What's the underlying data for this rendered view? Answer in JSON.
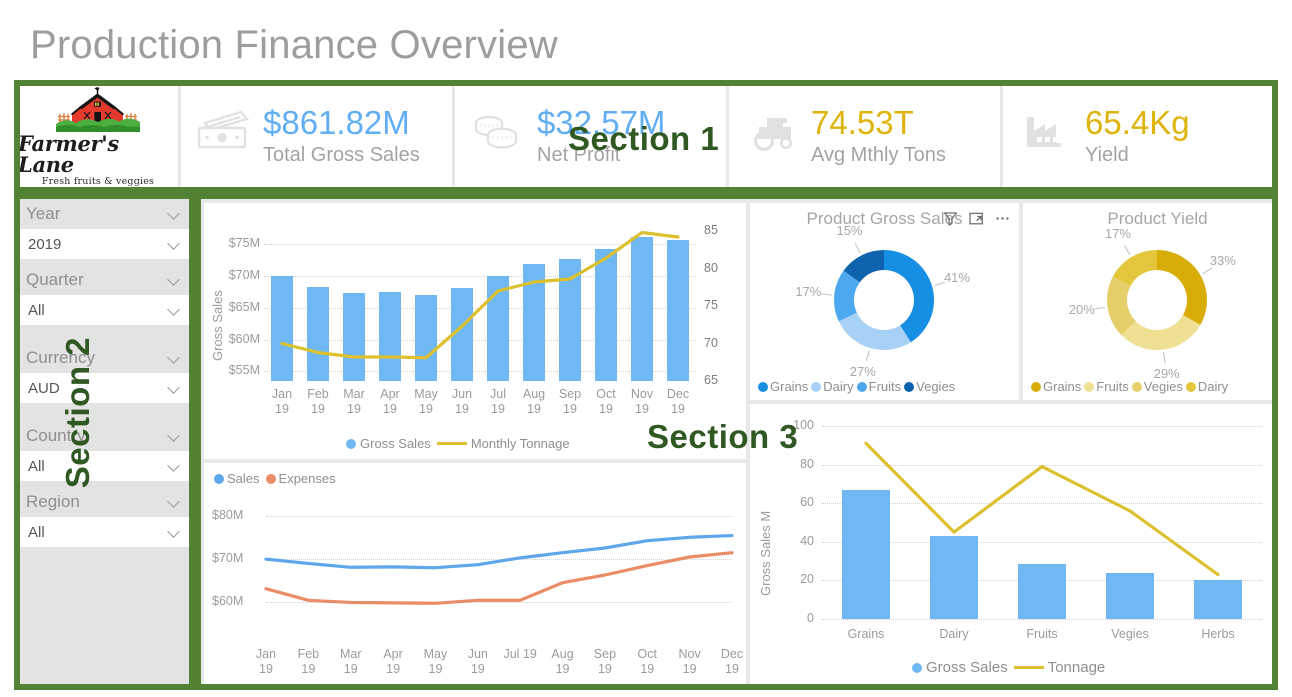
{
  "header": {
    "title": "Production Finance Overview"
  },
  "annotations": {
    "section1": "Section 1",
    "section2": "Section 2",
    "section3": "Section 3",
    "outline_color": "#528234"
  },
  "logo": {
    "name": "Farmer's Lane",
    "tagline": "Fresh fruits & veggies",
    "icon": "barn-icon"
  },
  "kpis": [
    {
      "icon": "cash-icon",
      "value": "$861.82M",
      "label": "Total Gross Sales",
      "color": "#62aef4"
    },
    {
      "icon": "coins-icon",
      "value": "$32.57M",
      "label": "Net Profit",
      "color": "#62aef4"
    },
    {
      "icon": "tractor-icon",
      "value": "74.53T",
      "label": "Avg Mthly Tons",
      "color": "#dfb40c"
    },
    {
      "icon": "factory-icon",
      "value": "65.4Kg",
      "label": "Yield",
      "color": "#dfb40c"
    }
  ],
  "filters": [
    {
      "title": "Year",
      "value": "2019"
    },
    {
      "title": "Quarter",
      "value": "All"
    },
    {
      "title": "Currency",
      "value": "AUD"
    },
    {
      "title": "Country",
      "value": "All"
    },
    {
      "title": "Region",
      "value": "All"
    }
  ],
  "visual_icons": {
    "filter": "filter-funnel-icon",
    "focus": "focus-mode-icon",
    "more": "more-options-icon"
  },
  "chart_data": [
    {
      "id": "monthly-combo",
      "type": "bar",
      "title": "",
      "categories": [
        "Jan 19",
        "Feb 19",
        "Mar 19",
        "Apr 19",
        "May 19",
        "Jun 19",
        "Jul 19",
        "Aug 19",
        "Sep 19",
        "Oct 19",
        "Nov 19",
        "Dec 19"
      ],
      "ylabel": "Gross Sales",
      "ylim": [
        53.5,
        77
      ],
      "yticks": [
        "$55M",
        "$60M",
        "$65M",
        "$70M",
        "$75M"
      ],
      "ytick_values": [
        55,
        60,
        65,
        70,
        75
      ],
      "y2lim": [
        65,
        85
      ],
      "y2ticks": [
        "65",
        "70",
        "75",
        "80",
        "85"
      ],
      "y2tick_values": [
        65,
        70,
        75,
        80,
        85
      ],
      "grid": true,
      "legend": [
        "Gross Sales",
        "Monthly Tonnage"
      ],
      "legend_position": "bottom",
      "series": [
        {
          "name": "Gross Sales",
          "kind": "bar",
          "color": "#70b8f4",
          "values": [
            69.9,
            68.2,
            67.3,
            67.4,
            67.0,
            68.0,
            70.0,
            71.8,
            72.6,
            74.2,
            76.0,
            75.6
          ]
        },
        {
          "name": "Monthly Tonnage",
          "kind": "line",
          "color": "#dcc02e",
          "axis": "y2",
          "values": [
            70.0,
            68.8,
            68.2,
            68.2,
            68.1,
            72.3,
            77.0,
            78.2,
            78.6,
            81.4,
            84.8,
            84.2
          ]
        }
      ]
    },
    {
      "id": "product-gross-sales",
      "type": "pie",
      "title": "Product Gross Sales",
      "labels": [
        "Grains",
        "Dairy",
        "Fruits",
        "Vegies"
      ],
      "values": [
        41,
        27,
        17,
        15
      ],
      "data_labels": [
        "41%",
        "27%",
        "17%",
        "15%"
      ],
      "colors": [
        "#168fe3",
        "#a8d2f5",
        "#4ea8ef",
        "#0f62ad"
      ],
      "legend": [
        "Grains",
        "Dairy",
        "Fruits",
        "Vegies"
      ],
      "legend_position": "bottom"
    },
    {
      "id": "product-yield",
      "type": "pie",
      "title": "Product Yield",
      "labels": [
        "Grains",
        "Fruits",
        "Vegies",
        "Dairy"
      ],
      "values": [
        33,
        29,
        20,
        17
      ],
      "data_labels": [
        "33%",
        "29%",
        "20%",
        "17%"
      ],
      "colors": [
        "#d9ad07",
        "#f0e094",
        "#e5cf6a",
        "#e3c63c"
      ],
      "legend": [
        "Grains",
        "Fruits",
        "Vegies",
        "Dairy"
      ],
      "legend_position": "bottom"
    },
    {
      "id": "sales-vs-expenses",
      "type": "line",
      "title": "",
      "categories": [
        "Jan 19",
        "Feb 19",
        "Mar 19",
        "Apr 19",
        "May 19",
        "Jun 19",
        "Jul 19",
        "Aug 19",
        "Sep 19",
        "Oct 19",
        "Nov 19",
        "Dec 19"
      ],
      "ylim": [
        55,
        83
      ],
      "yticks": [
        "$60M",
        "$70M",
        "$80M"
      ],
      "ytick_values": [
        60,
        70,
        80
      ],
      "grid": true,
      "legend": [
        "Sales",
        "Expenses"
      ],
      "legend_position": "top-left",
      "series": [
        {
          "name": "Sales",
          "color": "#5da7ea",
          "values": [
            69.9,
            68.9,
            68.0,
            68.1,
            67.9,
            68.6,
            70.2,
            71.4,
            72.5,
            74.2,
            75.0,
            75.4
          ]
        },
        {
          "name": "Expenses",
          "color": "#ea8c66",
          "values": [
            63.0,
            60.3,
            59.8,
            59.7,
            59.6,
            60.3,
            60.3,
            64.4,
            66.2,
            68.4,
            70.4,
            71.4
          ]
        }
      ]
    },
    {
      "id": "product-sales-tonnage",
      "type": "bar",
      "title": "",
      "categories": [
        "Grains",
        "Dairy",
        "Fruits",
        "Vegies",
        "Herbs"
      ],
      "ylabel": "Gross Sales M",
      "ylim": [
        0,
        100
      ],
      "yticks": [
        "0",
        "20",
        "40",
        "60",
        "80",
        "100"
      ],
      "ytick_values": [
        0,
        20,
        40,
        60,
        80,
        100
      ],
      "grid": true,
      "legend": [
        "Gross Sales",
        "Tonnage"
      ],
      "legend_position": "bottom",
      "series": [
        {
          "name": "Gross Sales",
          "kind": "bar",
          "color": "#70b8f4",
          "values": [
            67,
            43,
            28.5,
            24,
            20
          ]
        },
        {
          "name": "Tonnage",
          "kind": "line",
          "color": "#dcc02e",
          "values": [
            91,
            45,
            79,
            56,
            23
          ]
        }
      ]
    }
  ]
}
